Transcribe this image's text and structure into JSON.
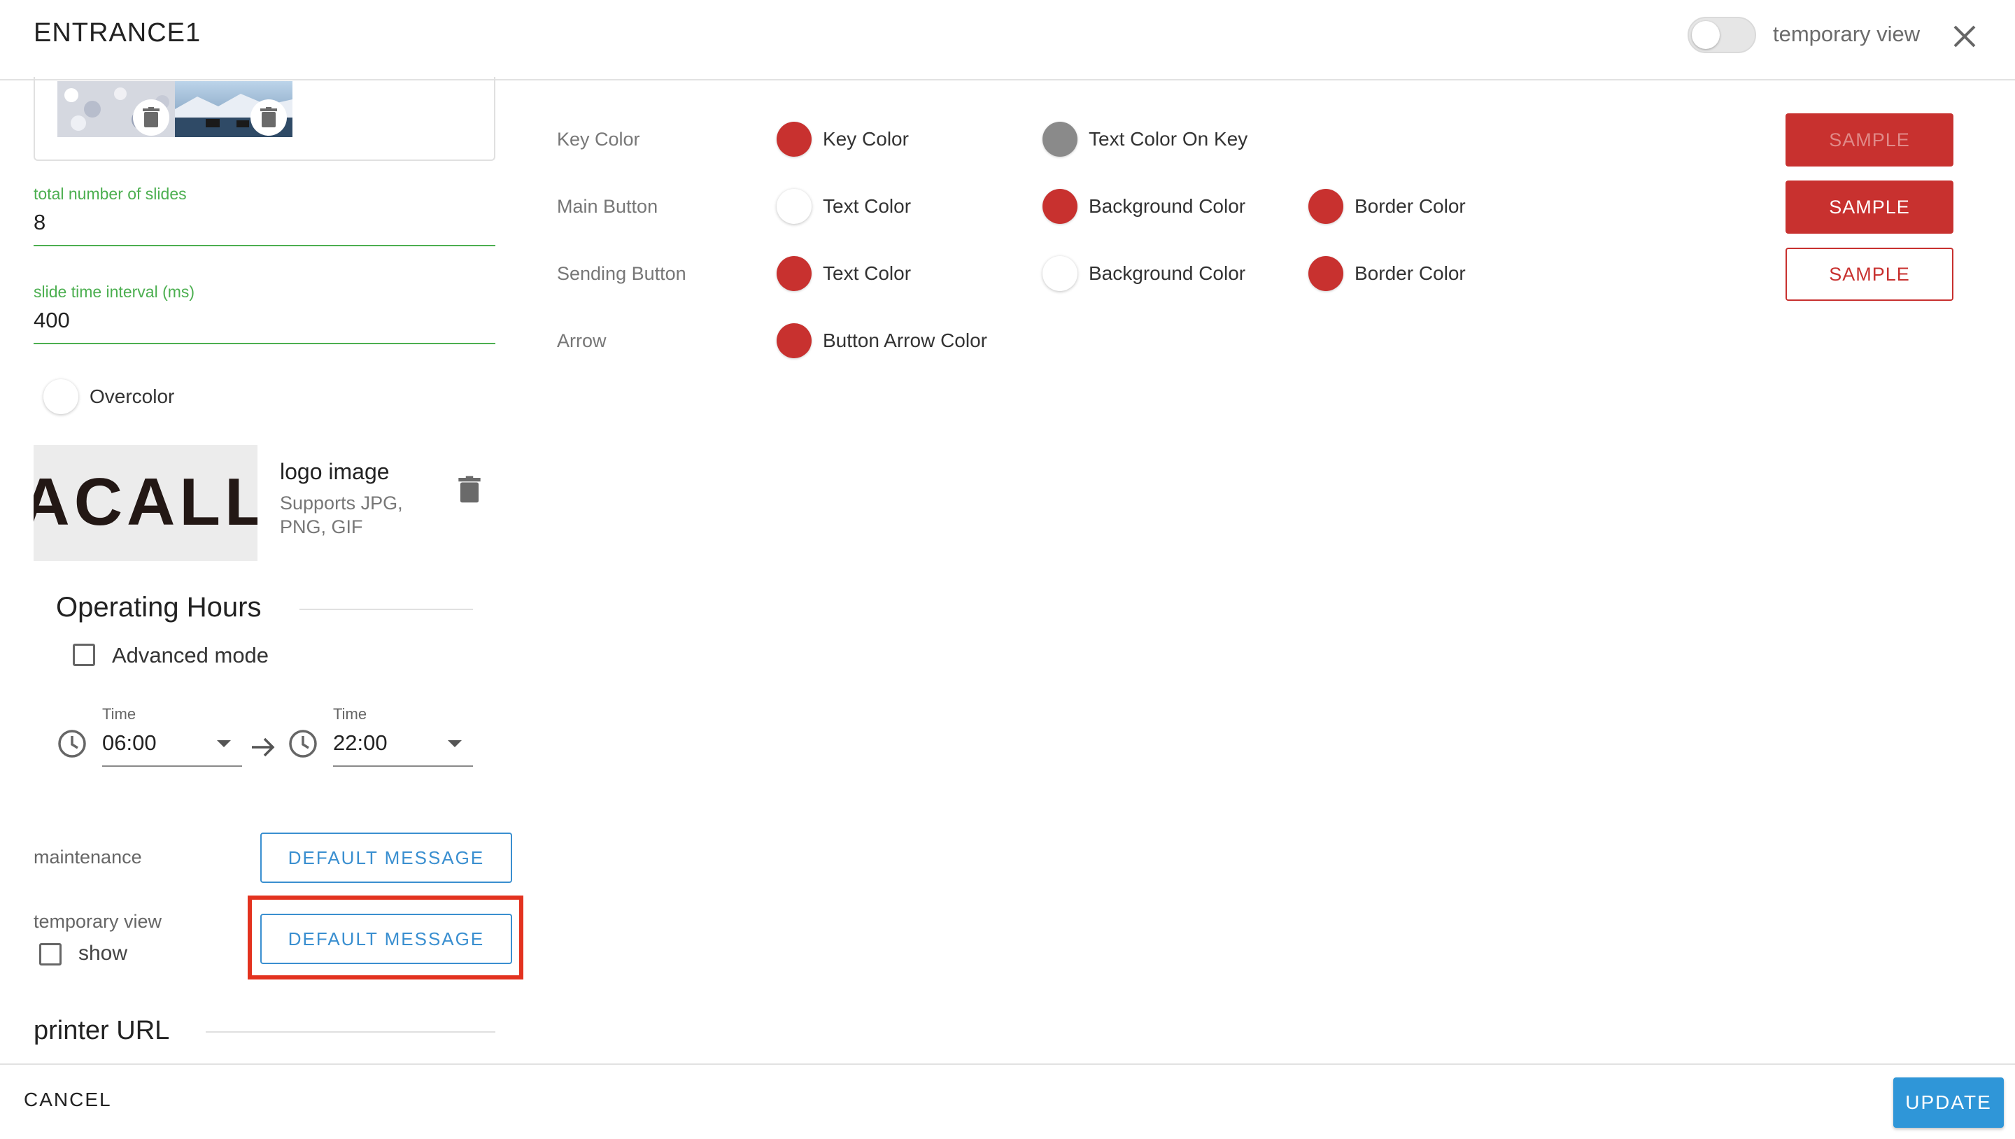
{
  "header": {
    "title": "ENTRANCE1",
    "toggle_label": "temporary view",
    "toggle_on": false
  },
  "slides": {
    "total_label": "total number of slides",
    "total_value": "8",
    "interval_label": "slide time interval (ms)",
    "interval_value": "400"
  },
  "overcolor": {
    "label": "Overcolor"
  },
  "logo": {
    "text": "ACALL",
    "title": "logo image",
    "subtitle": "Supports JPG, PNG, GIF"
  },
  "operating_hours": {
    "title": "Operating Hours",
    "advanced_label": "Advanced mode",
    "advanced_checked": false,
    "start_label": "Time",
    "start_value": "06:00",
    "end_label": "Time",
    "end_value": "22:00"
  },
  "maintenance": {
    "label": "maintenance",
    "button": "DEFAULT MESSAGE"
  },
  "temporary_view": {
    "label": "temporary view",
    "show_label": "show",
    "show_checked": false,
    "button": "DEFAULT MESSAGE"
  },
  "printer": {
    "title": "printer URL"
  },
  "colors": {
    "rows": [
      {
        "label": "Key Color",
        "items": [
          "Key Color",
          "Text Color On Key"
        ],
        "sample": "SAMPLE"
      },
      {
        "label": "Main Button",
        "items": [
          "Text Color",
          "Background Color",
          "Border Color"
        ],
        "sample": "SAMPLE"
      },
      {
        "label": "Sending Button",
        "items": [
          "Text Color",
          "Background Color",
          "Border Color"
        ],
        "sample": "SAMPLE"
      },
      {
        "label": "Arrow",
        "items": [
          "Button Arrow Color"
        ]
      }
    ],
    "accent": "#c8312f",
    "gray": "#8a8a8a"
  },
  "footer": {
    "cancel": "CANCEL",
    "update": "UPDATE"
  }
}
